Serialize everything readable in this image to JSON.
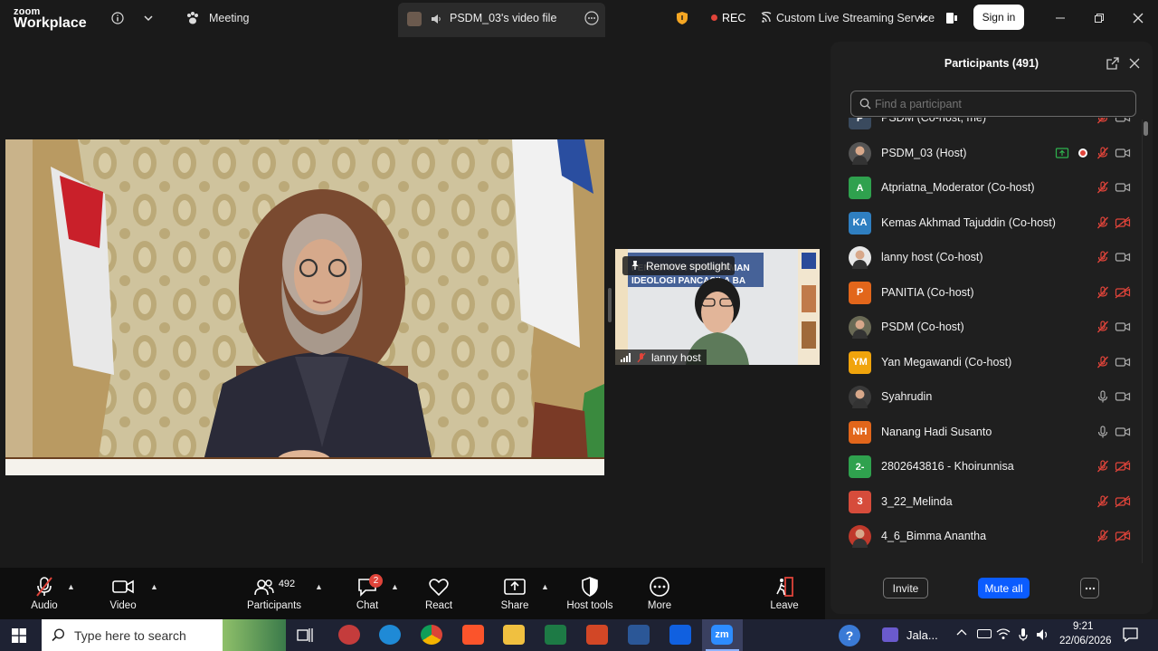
{
  "title_bar": {
    "brand_line1": "zoom",
    "brand_line2": "Workplace",
    "meeting_tab": "Meeting",
    "video_file_tab": "PSDM_03's video file",
    "rec_label": "REC",
    "streaming_label": "Custom Live Streaming Service",
    "sign_in": "Sign in"
  },
  "spotlight": {
    "remove_spotlight": "Remove spotlight",
    "name": "lanny host"
  },
  "participants_panel": {
    "title": "Participants (491)",
    "search_placeholder": "Find a participant",
    "participants": [
      {
        "name": "PSDM (Co-host, me)",
        "avatar": "P",
        "color": "#3a4a5e",
        "mic": "muted",
        "cam": "on"
      },
      {
        "name": "PSDM_03 (Host)",
        "avatar": "img",
        "color": "#555",
        "mic": "muted",
        "cam": "on",
        "sharing": true,
        "recording": true
      },
      {
        "name": "Atpriatna_Moderator (Co-host)",
        "avatar": "A",
        "color": "#2fa14e",
        "mic": "muted",
        "cam": "on"
      },
      {
        "name": "Kemas Akhmad Tajuddin (Co-host)",
        "avatar": "KA",
        "color": "#2f7fc1",
        "mic": "muted",
        "cam": "off"
      },
      {
        "name": "lanny host (Co-host)",
        "avatar": "img",
        "color": "#e8e8e8",
        "mic": "muted",
        "cam": "on"
      },
      {
        "name": "PANITIA (Co-host)",
        "avatar": "P",
        "color": "#e2661b",
        "mic": "muted",
        "cam": "off"
      },
      {
        "name": "PSDM (Co-host)",
        "avatar": "img",
        "color": "#6a6a55",
        "mic": "muted",
        "cam": "on"
      },
      {
        "name": "Yan Megawandi (Co-host)",
        "avatar": "YM",
        "color": "#f0a40c",
        "mic": "muted",
        "cam": "on"
      },
      {
        "name": "Syahrudin",
        "avatar": "img",
        "color": "#3a3a3a",
        "mic": "on",
        "cam": "on"
      },
      {
        "name": "Nanang Hadi Susanto",
        "avatar": "NH",
        "color": "#e2661b",
        "mic": "on",
        "cam": "on"
      },
      {
        "name": "2802643816 - Khoirunnisa",
        "avatar": "2-",
        "color": "#2fa14e",
        "mic": "muted",
        "cam": "off"
      },
      {
        "name": "3_22_Melinda",
        "avatar": "3",
        "color": "#d64c3b",
        "mic": "muted",
        "cam": "off"
      },
      {
        "name": "4_6_Bimma Anantha",
        "avatar": "img",
        "color": "#c0392b",
        "mic": "muted",
        "cam": "off"
      }
    ],
    "invite": "Invite",
    "mute_all": "Mute all"
  },
  "toolbar": {
    "audio": "Audio",
    "video": "Video",
    "participants": "Participants",
    "participant_count": "492",
    "chat": "Chat",
    "chat_badge": "2",
    "react": "React",
    "share": "Share",
    "host_tools": "Host tools",
    "more": "More",
    "leave": "Leave"
  },
  "taskbar": {
    "search_placeholder": "Type here to search",
    "media_label": "Jala...",
    "time": "9:21",
    "date": "22/06/2026"
  },
  "colors": {
    "accent": "#0b5cff",
    "muted_red": "#e0443a",
    "panel_bg": "#1f1f1f"
  }
}
